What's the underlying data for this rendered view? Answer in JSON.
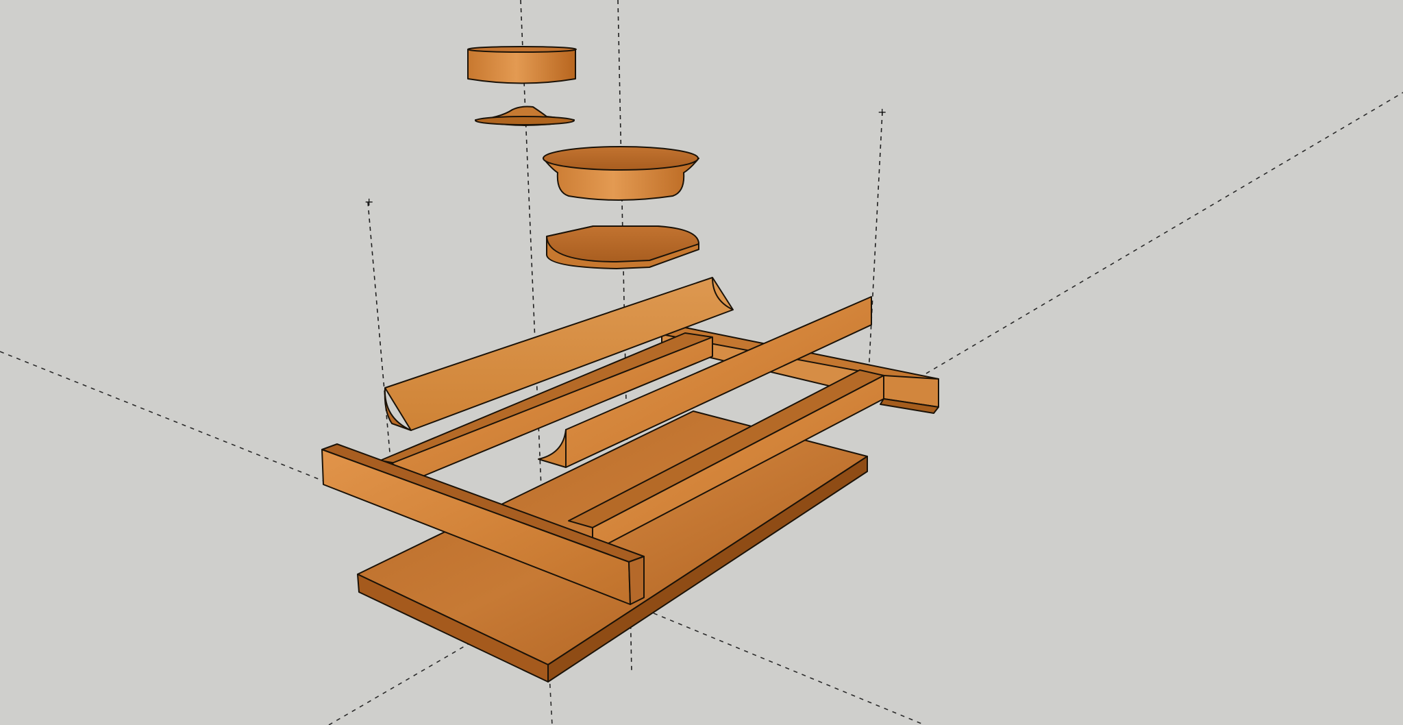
{
  "model": {
    "parts": [
      "cap-cylinder",
      "finial-flare",
      "bowl-disc",
      "base-plate",
      "cove-molding-back",
      "cove-molding-front",
      "rail-long-left",
      "rail-long-right",
      "stretcher-front",
      "stretcher-back",
      "base-board"
    ],
    "colors": {
      "background": "#cfcfcc",
      "wood_light": "#d98a3c",
      "wood_mid": "#c4722b",
      "wood_dark": "#9a5418",
      "edge": "#1a1208"
    }
  }
}
